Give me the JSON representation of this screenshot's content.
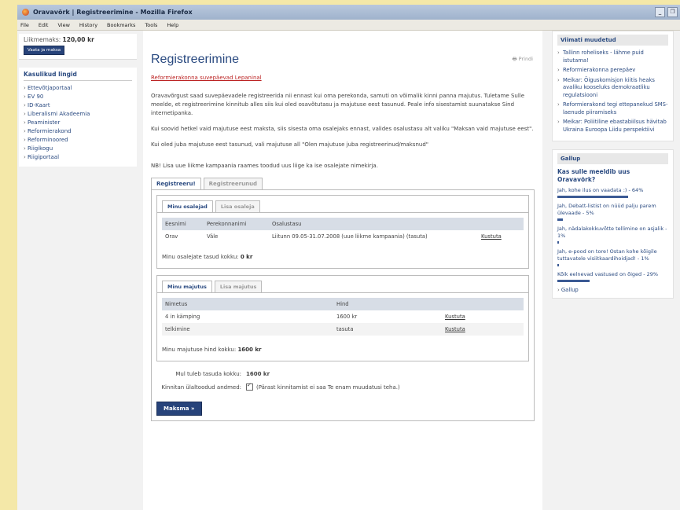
{
  "window": {
    "title": "Oravavõrk | Registreerimine - Mozilla Firefox"
  },
  "menu": [
    "File",
    "Edit",
    "View",
    "History",
    "Bookmarks",
    "Tools",
    "Help"
  ],
  "sidebar_left": {
    "cart_label": "Liikmemaks:",
    "cart_amount": "120,00 kr",
    "cart_button": "Vaata ja maksa",
    "links_title": "Kasulikud lingid",
    "links": [
      "Ettevõtjaportaal",
      "EV 90",
      "ID-Kaart",
      "Liberalismi Akadeemia",
      "Peaminister",
      "Reformierakond",
      "Reforminoored",
      "Riigikogu",
      "Riigiportaal"
    ]
  },
  "main": {
    "title": "Registreerimine",
    "print_label": "Prindi",
    "event_link": "Reformierakonna suvepäevad Lepaninal",
    "paragraphs": [
      "Oravavõrgust saad suvepäevadele registreerida nii ennast kui oma perekonda, samuti on võimalik kinni panna majutus. Tuletame Sulle meelde, et registreerimine kinnitub alles siis kui oled osavõtutasu ja majutuse eest tasunud. Peale info sisestamist suunatakse Sind internetipanka.",
      "Kui soovid hetkel vaid majutuse eest maksta, siis sisesta oma osalejaks ennast, valides osalustasu alt valiku \"Maksan vaid majutuse eest\".",
      "Kui oled juba majutuse eest tasunud, vali majutuse all \"Olen majutuse juba registreerinud/maksnud\"",
      "NB! Lisa uue liikme kampaania raames toodud uus liige ka ise osalejate nimekirja."
    ],
    "tabs": [
      "Registreeru!",
      "Registreerunud"
    ],
    "participants": {
      "tabs": [
        "Minu osalejad",
        "Lisa osaleja"
      ],
      "columns": [
        "Eesnimi",
        "Perekonnanimi",
        "Osalustasu",
        ""
      ],
      "rows": [
        {
          "first": "Orav",
          "last": "Väle",
          "fee": "Liitunn 09.05-31.07.2008 (uue liikme kampaania) (tasuta)",
          "action": "Kustuta"
        }
      ],
      "total_label": "Minu osalejate tasud kokku:",
      "total_value": "0 kr"
    },
    "accommodation": {
      "tabs": [
        "Minu majutus",
        "Lisa majutus"
      ],
      "columns": [
        "Nimetus",
        "Hind",
        ""
      ],
      "rows": [
        {
          "name": "4 in kämping",
          "price": "1600 kr",
          "action": "Kustuta"
        },
        {
          "name": "telkimine",
          "price": "tasuta",
          "action": "Kustuta"
        }
      ],
      "total_label": "Minu majutuse hind kokku:",
      "total_value": "1600 kr"
    },
    "summary": {
      "pay_total_label": "Mul tuleb tasuda kokku:",
      "pay_total_value": "1600 kr",
      "confirm_label": "Kinnitan ülaltoodud andmed:",
      "confirm_note": "(Pärast kinnitamist ei saa Te enam muudatusi teha.)"
    },
    "pay_button": "Maksma »"
  },
  "sidebar_right": {
    "recent_title": "Viimati muudetud",
    "recent": [
      "Tallinn roheliseks - lähme puid istutama!",
      "Reformierakonna perepäev",
      "Meikar: Õiguskomisjon kiitis heaks avaliku kooseluks demokraatliku regulatsiooni",
      "Reformierakond tegi ettepanekud SMS-laenude piiramiseks",
      "Meikar: Poliitiline ebastabiilsus hävitab Ukraina Euroopa Liidu perspektiivi"
    ],
    "poll_title": "Gallup",
    "poll_question": "Kas sulle meeldib uus Oravavõrk?",
    "poll_options": [
      {
        "text": "Jah, kohe ilus on vaadata :) - 64%",
        "pct": 64
      },
      {
        "text": "Jah, Debatt-listist on nüüd palju parem ülevaade - 5%",
        "pct": 5
      },
      {
        "text": "Jah, nädalakokkuvõtte tellimine on asjalik - 1%",
        "pct": 1
      },
      {
        "text": "Jah, e-pood on tore! Ostan kohe kõigile tuttavatele visiitkaardihoidjad! - 1%",
        "pct": 1
      },
      {
        "text": "Kõik eelnevad vastused on õiged - 29%",
        "pct": 29
      }
    ],
    "poll_link": "Gallup"
  }
}
